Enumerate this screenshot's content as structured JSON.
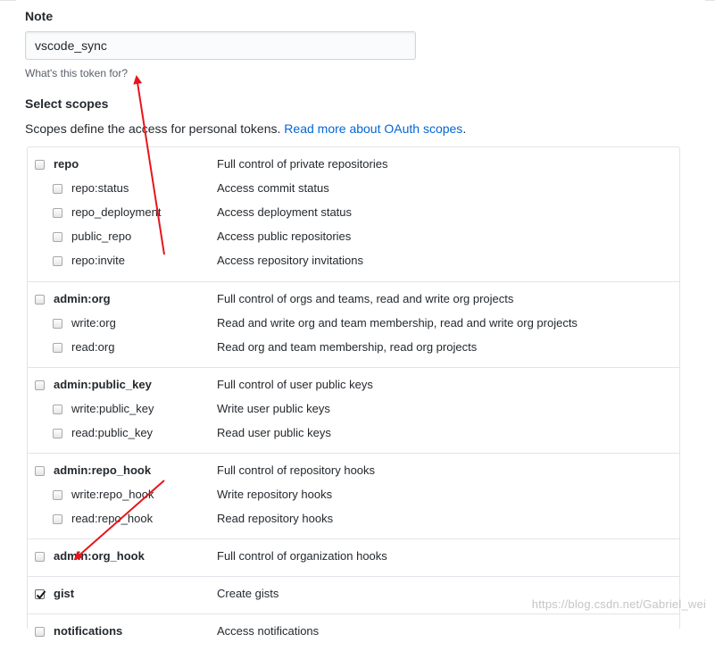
{
  "note": {
    "label": "Note",
    "value": "vscode_sync",
    "hint": "What's this token for?"
  },
  "scopes": {
    "title": "Select scopes",
    "description": "Scopes define the access for personal tokens.",
    "link_text": "Read more about OAuth scopes",
    "period": "."
  },
  "groups": [
    {
      "name": "repo",
      "desc": "Full control of private repositories",
      "checked": false,
      "children": [
        {
          "name": "repo:status",
          "desc": "Access commit status",
          "checked": false
        },
        {
          "name": "repo_deployment",
          "desc": "Access deployment status",
          "checked": false
        },
        {
          "name": "public_repo",
          "desc": "Access public repositories",
          "checked": false
        },
        {
          "name": "repo:invite",
          "desc": "Access repository invitations",
          "checked": false
        }
      ]
    },
    {
      "name": "admin:org",
      "desc": "Full control of orgs and teams, read and write org projects",
      "checked": false,
      "children": [
        {
          "name": "write:org",
          "desc": "Read and write org and team membership, read and write org projects",
          "checked": false
        },
        {
          "name": "read:org",
          "desc": "Read org and team membership, read org projects",
          "checked": false
        }
      ]
    },
    {
      "name": "admin:public_key",
      "desc": "Full control of user public keys",
      "checked": false,
      "children": [
        {
          "name": "write:public_key",
          "desc": "Write user public keys",
          "checked": false
        },
        {
          "name": "read:public_key",
          "desc": "Read user public keys",
          "checked": false
        }
      ]
    },
    {
      "name": "admin:repo_hook",
      "desc": "Full control of repository hooks",
      "checked": false,
      "children": [
        {
          "name": "write:repo_hook",
          "desc": "Write repository hooks",
          "checked": false
        },
        {
          "name": "read:repo_hook",
          "desc": "Read repository hooks",
          "checked": false
        }
      ]
    },
    {
      "name": "admin:org_hook",
      "desc": "Full control of organization hooks",
      "checked": false,
      "children": []
    },
    {
      "name": "gist",
      "desc": "Create gists",
      "checked": true,
      "children": []
    },
    {
      "name": "notifications",
      "desc": "Access notifications",
      "checked": false,
      "children": []
    }
  ],
  "annotation_color": "#e8141b",
  "watermark": "https://blog.csdn.net/Gabriel_wei"
}
